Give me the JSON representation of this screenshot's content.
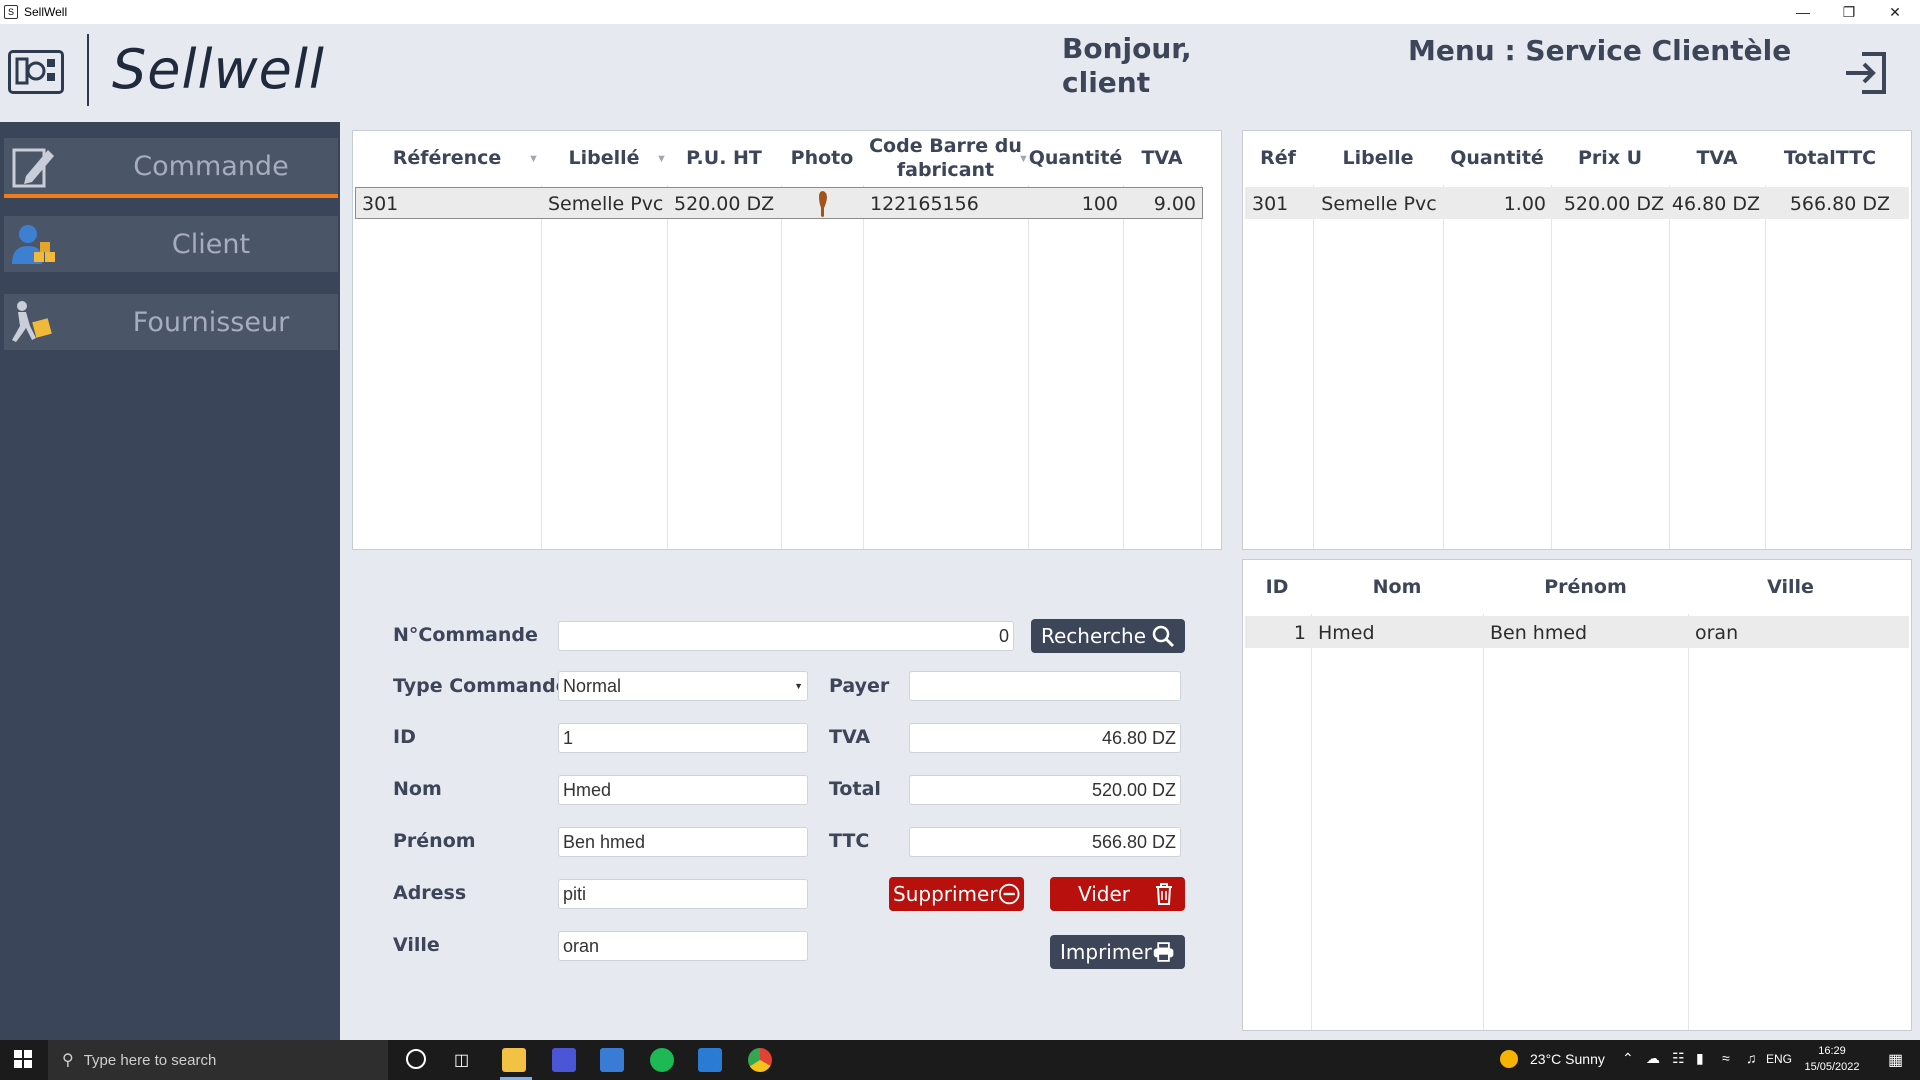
{
  "window": {
    "title": "SellWell"
  },
  "header": {
    "brand": "Sellwell",
    "greeting_line1": "Bonjour,",
    "greeting_line2": "client",
    "menu_title": "Menu : Service Clientèle"
  },
  "sidebar": {
    "items": [
      {
        "label": "Commande",
        "icon": "edit-icon",
        "active": true
      },
      {
        "label": "Client",
        "icon": "user-boxes-icon"
      },
      {
        "label": "Fournisseur",
        "icon": "delivery-icon"
      }
    ]
  },
  "products_grid": {
    "columns": [
      "Référence",
      "Libellé",
      "P.U. HT",
      "Photo",
      "Code Barre du fabricant",
      "Quantité",
      "TVA"
    ],
    "rows": [
      {
        "reference": "301",
        "libelle": "Semelle Pvc",
        "pu_ht": "520.00 DZ",
        "photo": "insole-thumbnail",
        "code_barre": "122165156",
        "quantite": "100",
        "tva": "9.00"
      }
    ]
  },
  "cart_grid": {
    "columns": [
      "Réf",
      "Libelle",
      "Quantité",
      "Prix U",
      "TVA",
      "TotalTTC"
    ],
    "rows": [
      {
        "ref": "301",
        "libelle": "Semelle Pvc",
        "quantite": "1.00",
        "prix_u": "520.00 DZ",
        "tva": "46.80 DZ",
        "total_ttc": "566.80 DZ"
      }
    ]
  },
  "clients_grid": {
    "columns": [
      "ID",
      "Nom",
      "Prénom",
      "Ville"
    ],
    "rows": [
      {
        "id": "1",
        "nom": "Hmed",
        "prenom": "Ben hmed",
        "ville": "oran"
      }
    ]
  },
  "form": {
    "labels": {
      "n_commande": "N°Commande",
      "type_commande": "Type Commande",
      "id": "ID",
      "nom": "Nom",
      "prenom": "Prénom",
      "adress": "Adress",
      "ville": "Ville",
      "payer": "Payer",
      "tva": "TVA",
      "total": "Total",
      "ttc": "TTC"
    },
    "values": {
      "n_commande": "0",
      "type_commande": "Normal",
      "id": "1",
      "nom": "Hmed",
      "prenom": "Ben hmed",
      "adress": "piti",
      "ville": "oran",
      "payer": "",
      "tva": "46.80 DZ",
      "total": "520.00 DZ",
      "ttc": "566.80 DZ"
    },
    "buttons": {
      "recherche": "Recherche",
      "supprimer": "Supprimer",
      "vider": "Vider",
      "imprimer": "Imprimer"
    }
  },
  "taskbar": {
    "search_placeholder": "Type here to search",
    "weather": "23°C  Sunny",
    "lang": "ENG",
    "time": "16:29",
    "date": "15/05/2022"
  },
  "colors": {
    "sidebar_bg": "#3b4559",
    "accent_orange": "#f07d1a",
    "danger_red": "#b8100c",
    "button_dark": "#3c4658"
  }
}
